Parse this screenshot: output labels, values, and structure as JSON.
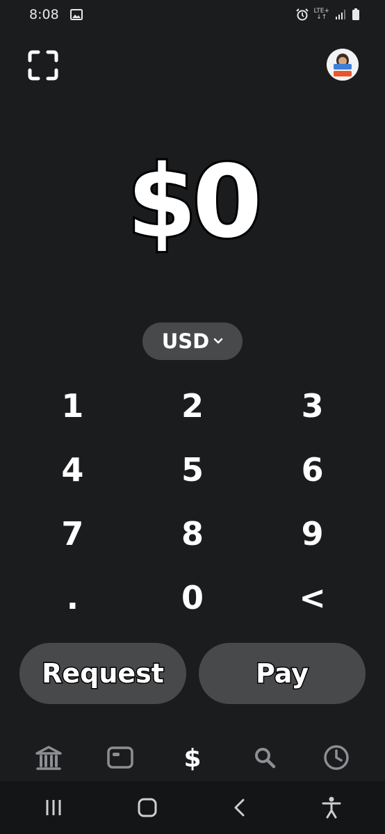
{
  "status_bar": {
    "time": "8:08",
    "network_label": "LTE+",
    "icons": [
      "image-icon",
      "alarm-icon",
      "signal-icon",
      "battery-icon"
    ]
  },
  "header": {
    "scan_icon": "qr-scan-icon",
    "avatar": "profile-avatar"
  },
  "amount": {
    "value": "$0"
  },
  "currency": {
    "label": "USD",
    "icon": "chevron-down-icon"
  },
  "keypad": {
    "keys": [
      "1",
      "2",
      "3",
      "4",
      "5",
      "6",
      "7",
      "8",
      "9",
      ".",
      "0",
      "<"
    ]
  },
  "actions": {
    "request_label": "Request",
    "pay_label": "Pay"
  },
  "tab_bar": {
    "tabs": [
      "bank-icon",
      "card-icon",
      "dollar-icon",
      "search-icon",
      "clock-icon"
    ],
    "active": "dollar-icon"
  },
  "colors": {
    "background": "#1b1c1e",
    "pill": "#48494b",
    "text": "#ffffff",
    "tab_inactive": "#8e8f93"
  }
}
